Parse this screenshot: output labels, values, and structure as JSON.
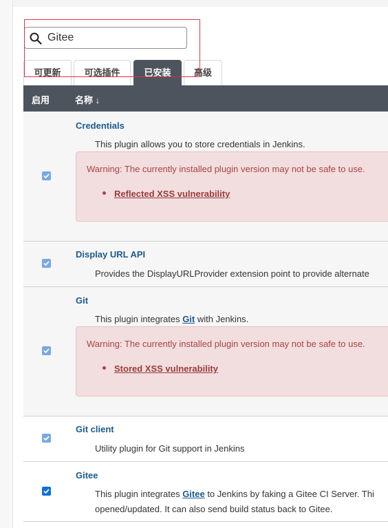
{
  "search": {
    "value": "Gitee"
  },
  "tabs": [
    {
      "label": "可更新"
    },
    {
      "label": "可选插件"
    },
    {
      "label": "已安装"
    },
    {
      "label": "高级"
    }
  ],
  "table": {
    "col_enable": "启用",
    "col_name": "名称 ↓"
  },
  "plugins": [
    {
      "name": "Credentials",
      "desc": "This plugin allows you to store credentials in Jenkins.",
      "warning": "Warning: The currently installed plugin version may not be safe to use.",
      "vuln": "Reflected XSS vulnerability",
      "enabled": true
    },
    {
      "name": "Display URL API",
      "desc": "Provides the DisplayURLProvider extension point to provide alternate",
      "enabled": true
    },
    {
      "name": "Git",
      "desc_pre": "This plugin integrates ",
      "desc_link": "Git",
      "desc_post": " with Jenkins.",
      "warning": "Warning: The currently installed plugin version may not be safe to use.",
      "vuln": "Stored XSS vulnerability",
      "enabled": true
    },
    {
      "name": "Git client",
      "desc": "Utility plugin for Git support in Jenkins",
      "enabled": true
    },
    {
      "name": "Gitee",
      "desc_pre": "This plugin integrates ",
      "desc_link": "Gitee",
      "desc_post": " to Jenkins by faking a Gitee CI Server. Thi",
      "desc_line2": "opened/updated. It can also send build status back to Gitee.",
      "enabled": true
    }
  ]
}
